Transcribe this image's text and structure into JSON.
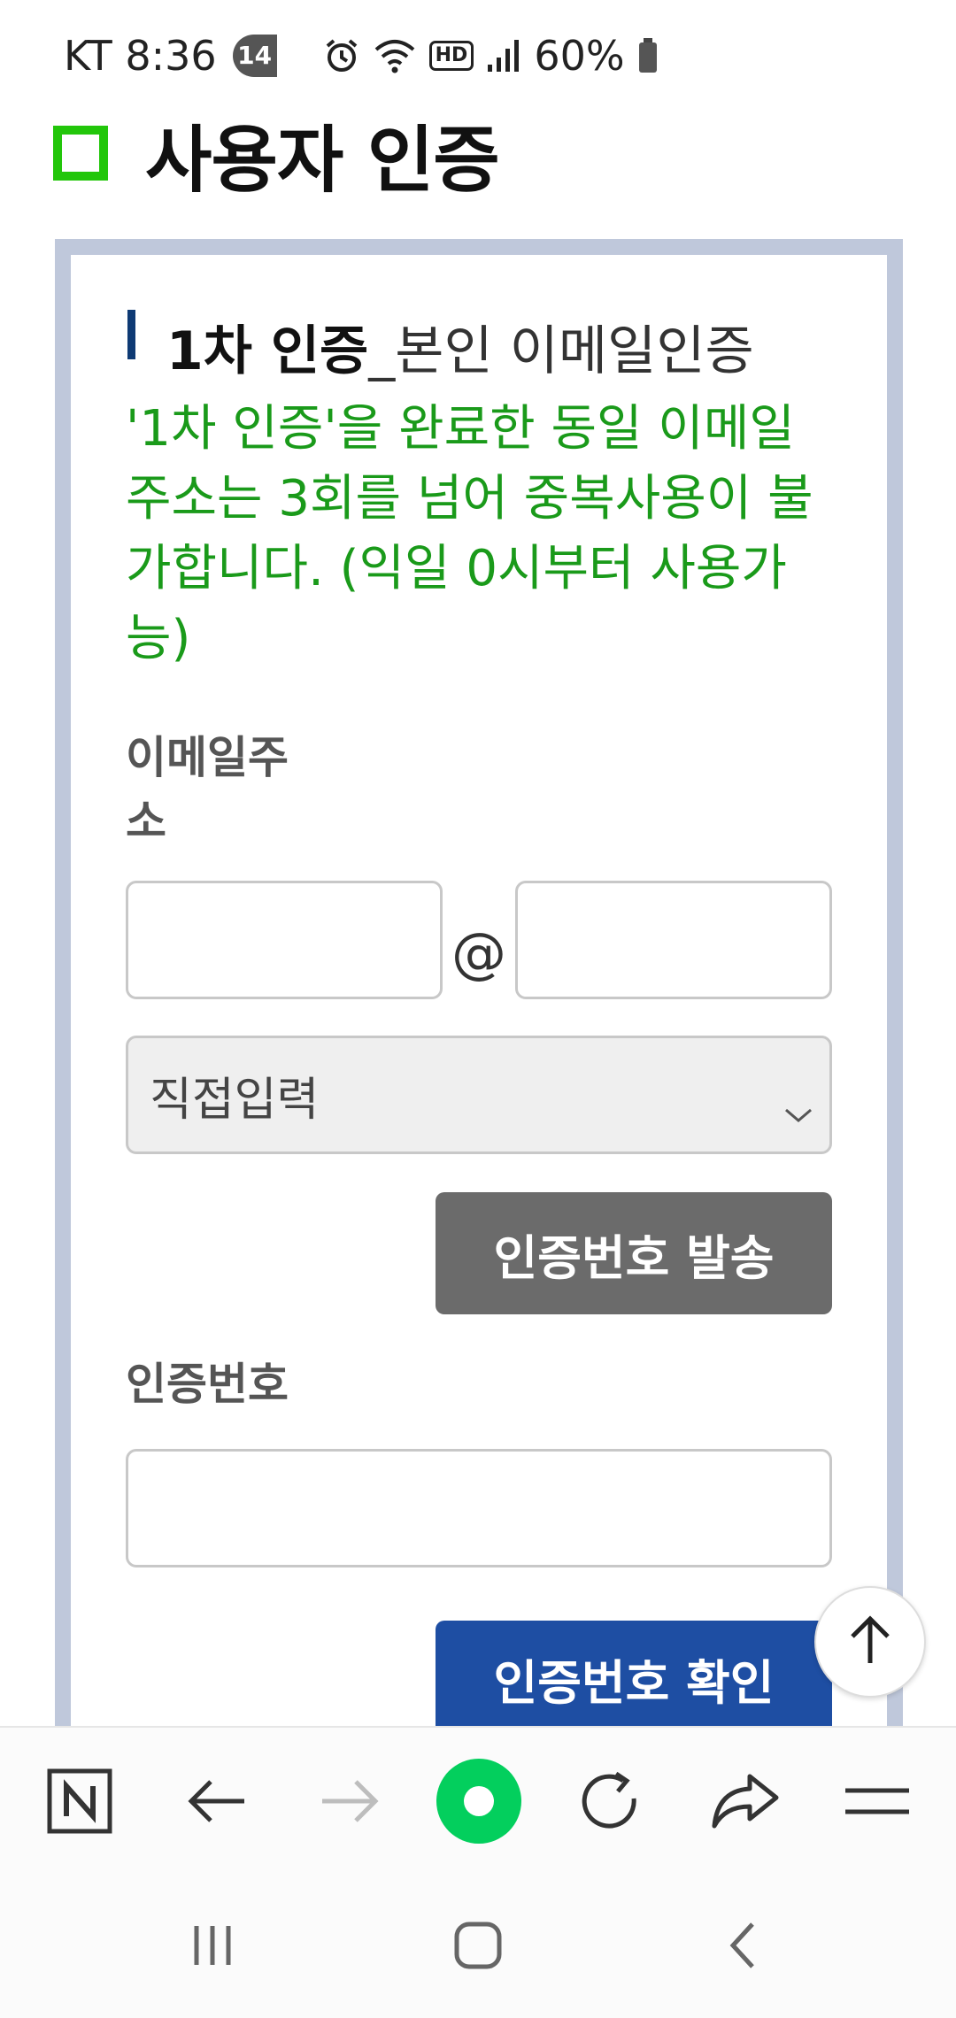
{
  "status_bar": {
    "carrier_time": "KT 8:36",
    "notification_count": "14",
    "battery": "60%",
    "icons": [
      "alarm-icon",
      "wifi-icon",
      "hd-icon",
      "signal-icon",
      "battery-icon"
    ],
    "hd_label": "HD"
  },
  "page": {
    "title": "사용자 인증",
    "title_accent_color": "#22c60a"
  },
  "section": {
    "heading_strong": "1차 인증",
    "heading_light": "_본인 이메일인증",
    "notice": "'1차 인증'을 완료한 동일 이메일 주소는 3회를 넘어 중복사용이 불가합니다. (익일 0시부터 사용가능)",
    "notice_color": "#1a9a1a"
  },
  "form": {
    "email_label": "이메일주소",
    "email_local_value": "",
    "at_symbol": "@",
    "email_domain_value": "",
    "domain_select_value": "직접입력",
    "send_button_label": "인증번호 발송",
    "code_label": "인증번호",
    "code_value": "",
    "confirm_button_label": "인증번호 확인",
    "confirm_button_color": "#1e4ea3",
    "send_button_color": "#6b6b6b"
  },
  "browser_toolbar": {
    "items": [
      "naver-home-icon",
      "back-arrow-icon",
      "forward-arrow-icon",
      "green-dot-icon",
      "refresh-icon",
      "share-icon",
      "menu-icon"
    ],
    "brand_color": "#03cf5d"
  },
  "nav_bar": {
    "items": [
      "recent-apps-icon",
      "home-icon",
      "back-icon"
    ]
  }
}
